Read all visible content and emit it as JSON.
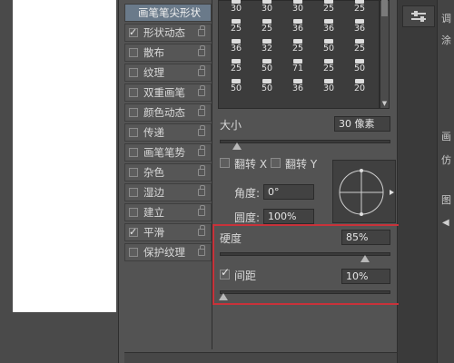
{
  "brush_tip_header": "画笔笔尖形状",
  "list_items": [
    {
      "label": "形状动态",
      "checked": true
    },
    {
      "label": "散布",
      "checked": false
    },
    {
      "label": "纹理",
      "checked": false
    },
    {
      "label": "双重画笔",
      "checked": false
    },
    {
      "label": "颜色动态",
      "checked": false
    },
    {
      "label": "传递",
      "checked": false
    },
    {
      "label": "画笔笔势",
      "checked": false
    },
    {
      "label": "杂色",
      "checked": false
    },
    {
      "label": "湿边",
      "checked": false
    },
    {
      "label": "建立",
      "checked": false
    },
    {
      "label": "平滑",
      "checked": true
    },
    {
      "label": "保护纹理",
      "checked": false
    }
  ],
  "brush_presets": [
    [
      "30",
      "30",
      "30",
      "25",
      "25"
    ],
    [
      "25",
      "25",
      "36",
      "36",
      "36"
    ],
    [
      "36",
      "32",
      "25",
      "50",
      "25"
    ],
    [
      "25",
      "50",
      "71",
      "25",
      "50"
    ],
    [
      "50",
      "50",
      "36",
      "30",
      "20"
    ]
  ],
  "size": {
    "label": "大小",
    "value": "30 像素",
    "fraction": 0.1
  },
  "flip_x": {
    "label": "翻转 X",
    "checked": false
  },
  "flip_y": {
    "label": "翻转 Y",
    "checked": false
  },
  "angle": {
    "label": "角度:",
    "value": "0°"
  },
  "roundness": {
    "label": "圆度:",
    "value": "100%"
  },
  "hardness": {
    "label": "硬度",
    "value": "85%",
    "fraction": 0.85
  },
  "spacing": {
    "label": "间距",
    "value": "10%",
    "checked": true,
    "fraction": 0.02
  },
  "right_strip": {
    "tab_label_1": "调",
    "tab_label_2": "涂",
    "tab_label_3": "画",
    "tab_label_4": "仿",
    "tab_label_5": "图"
  },
  "colors": {
    "highlight_box": "#c8323a",
    "panel": "#535353"
  }
}
